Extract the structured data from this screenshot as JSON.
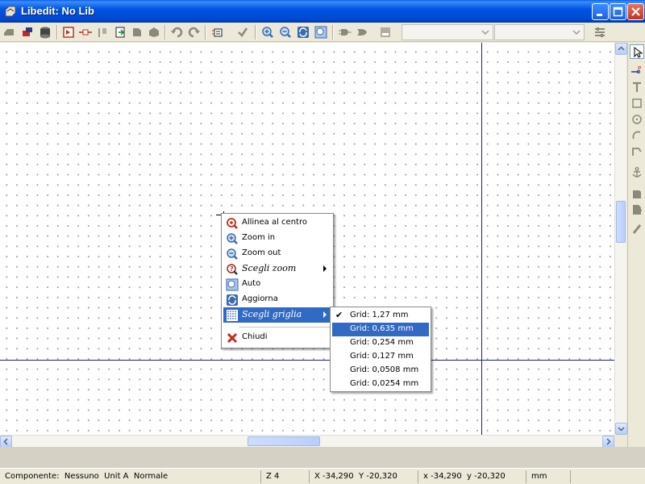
{
  "window": {
    "title": "Libedit: No Lib",
    "controls": [
      "minimize",
      "maximize",
      "close"
    ]
  },
  "toolbar": {
    "icons": [
      "new-component-icon",
      "import-component-icon",
      "save-library-icon",
      "component-properties-icon",
      "pin-table-icon",
      "delete-icon",
      "export-icon",
      "copy-icon",
      "paste-icon",
      "undo-icon",
      "redo-icon",
      "edit-pins-icon",
      "check-icon",
      "zoom-in-icon",
      "zoom-out-icon",
      "redraw-icon",
      "zoom-auto-icon",
      "de-morgan-normal-icon",
      "de-morgan-convert-icon",
      "datasheet-icon"
    ],
    "unit_combo_value": "",
    "alias_combo_value": ""
  },
  "right_tools": [
    "select-arrow-icon",
    "add-pin-icon",
    "add-text-icon",
    "add-rectangle-icon",
    "add-circle-icon",
    "add-arc-icon",
    "add-polyline-icon",
    "anchor-icon",
    "import-shape-icon",
    "export-shape-icon",
    "delete-tool-icon"
  ],
  "context_menu": {
    "items": [
      {
        "label": "Allinea al centro",
        "icon": "zoom-center-icon",
        "italic": false,
        "submenu": false,
        "highlighted": false
      },
      {
        "label": "Zoom in",
        "icon": "zoom-in-icon",
        "italic": false,
        "submenu": false,
        "highlighted": false
      },
      {
        "label": "Zoom out",
        "icon": "zoom-out-icon",
        "italic": false,
        "submenu": false,
        "highlighted": false
      },
      {
        "label": "Scegli zoom",
        "icon": "zoom-select-icon",
        "italic": true,
        "submenu": true,
        "highlighted": false
      },
      {
        "label": "Auto",
        "icon": "zoom-auto-icon",
        "italic": false,
        "submenu": false,
        "highlighted": false
      },
      {
        "label": "Aggiorna",
        "icon": "refresh-icon",
        "italic": false,
        "submenu": false,
        "highlighted": false
      },
      {
        "label": "Scegli griglia",
        "icon": "grid-icon",
        "italic": true,
        "submenu": true,
        "highlighted": true
      },
      {
        "label": "Chiudi",
        "icon": "close-x-icon",
        "italic": false,
        "submenu": false,
        "highlighted": false
      }
    ]
  },
  "grid_submenu": {
    "items": [
      {
        "label": "Grid: 1,27 mm",
        "checked": true,
        "highlighted": false
      },
      {
        "label": "Grid: 0,635 mm",
        "checked": false,
        "highlighted": true
      },
      {
        "label": "Grid: 0,254 mm",
        "checked": false,
        "highlighted": false
      },
      {
        "label": "Grid: 0,127 mm",
        "checked": false,
        "highlighted": false
      },
      {
        "label": "Grid: 0,0508 mm",
        "checked": false,
        "highlighted": false
      },
      {
        "label": "Grid: 0,0254 mm",
        "checked": false,
        "highlighted": false
      }
    ],
    "check_glyph": "✔"
  },
  "status": {
    "component": "Componente:  Nessuno  Unit A  Normale",
    "zoom": "Z 4",
    "abs_coords": "X -34,290  Y -20,320",
    "rel_coords": "x -34,290  y -20,320",
    "units": "mm"
  },
  "colors": {
    "title_bar": "#0054e3",
    "menu_highlight": "#316ac5",
    "axis": "#1f1f86",
    "grid_dot": "#9a9a9a"
  }
}
